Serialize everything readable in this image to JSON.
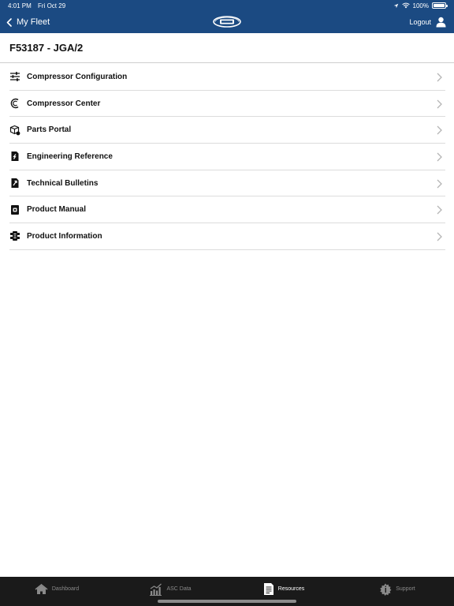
{
  "status": {
    "time": "4:01 PM",
    "date": "Fri Oct 29",
    "battery": "100%"
  },
  "nav": {
    "back_label": "My Fleet",
    "logout_label": "Logout"
  },
  "page": {
    "title": "F53187 - JGA/2"
  },
  "menu": {
    "items": [
      {
        "label": "Compressor Configuration",
        "icon": "sliders-icon"
      },
      {
        "label": "Compressor Center",
        "icon": "compressor-center-icon"
      },
      {
        "label": "Parts Portal",
        "icon": "box-icon"
      },
      {
        "label": "Engineering Reference",
        "icon": "engineering-doc-icon"
      },
      {
        "label": "Technical Bulletins",
        "icon": "bulletin-doc-icon"
      },
      {
        "label": "Product Manual",
        "icon": "manual-icon"
      },
      {
        "label": "Product Information",
        "icon": "product-info-icon"
      }
    ]
  },
  "tabs": [
    {
      "label": "Dashboard",
      "icon": "home-icon",
      "active": false
    },
    {
      "label": "ASC Data",
      "icon": "chart-icon",
      "active": false
    },
    {
      "label": "Resources",
      "icon": "document-icon",
      "active": true
    },
    {
      "label": "Support",
      "icon": "support-icon",
      "active": false
    }
  ],
  "colors": {
    "header": "#1b4a82",
    "tabbar": "#1a1a1a",
    "tab_active": "#ffffff",
    "tab_inactive": "#8a8a8a"
  }
}
